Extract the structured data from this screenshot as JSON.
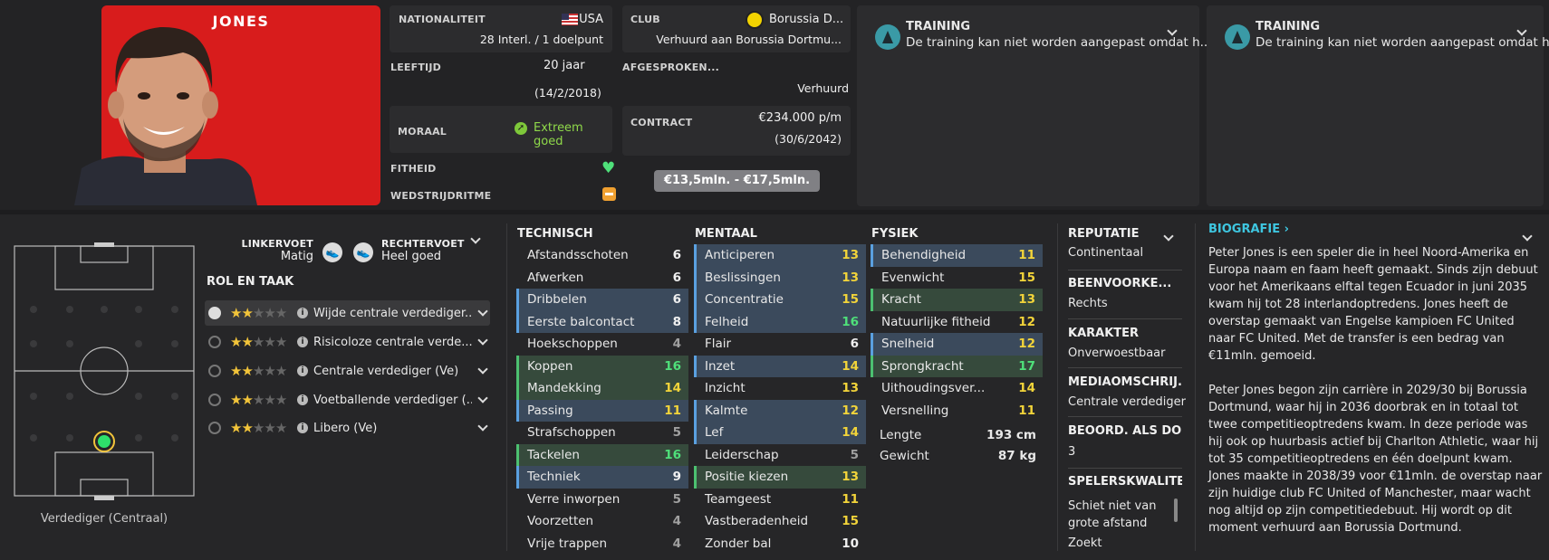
{
  "player": {
    "name": "JONES"
  },
  "info": {
    "nationality_label": "NATIONALITEIT",
    "nationality_value": "USA",
    "caps": "28 Interl. / 1 doelpunt",
    "club_label": "CLUB",
    "club_value": "Borussia D...",
    "club_loan": "Verhuurd aan Borussia Dortmu...",
    "age_label": "LEEFTIJD",
    "age_value": "20 jaar",
    "dob": "(14/2/2018)",
    "agreed_label": "AFGESPROKEN...",
    "agreed_value": "Verhuurd",
    "morale_label": "MORAAL",
    "morale_value": "Extreem goed",
    "contract_label": "CONTRACT",
    "contract_value": "€234.000 p/m",
    "contract_end": "(30/6/2042)",
    "fitness_label": "FITHEID",
    "match_label": "WEDSTRIJDRITME",
    "value_range": "€13,5mln. - €17,5mln."
  },
  "training_cards": [
    {
      "title": "TRAINING",
      "text": "De training kan niet worden aangepast omdat h..."
    },
    {
      "title": "TRAINING",
      "text": "De training kan niet worden aangepast omdat h..."
    }
  ],
  "pitch": {
    "position_caption": "Verdediger (Centraal)"
  },
  "feet": {
    "left_label": "LINKERVOET",
    "left_value": "Matig",
    "right_label": "RECHTERVOET",
    "right_value": "Heel goed"
  },
  "roles": {
    "title": "ROL EN TAAK",
    "items": [
      {
        "label": "Wijde centrale verdediger...",
        "stars": 2
      },
      {
        "label": "Risicoloze centrale verde...",
        "stars": 2
      },
      {
        "label": "Centrale verdediger (Ve)",
        "stars": 2
      },
      {
        "label": "Voetballende verdediger (...",
        "stars": 2
      },
      {
        "label": "Libero (Ve)",
        "stars": 2
      }
    ]
  },
  "attributes": {
    "technical_title": "TECHNISCH",
    "technical": [
      {
        "name": "Afstandsschoten",
        "value": "6",
        "hl": ""
      },
      {
        "name": "Afwerken",
        "value": "6",
        "hl": ""
      },
      {
        "name": "Dribbelen",
        "value": "6",
        "hl": "b"
      },
      {
        "name": "Eerste balcontact",
        "value": "8",
        "hl": "b"
      },
      {
        "name": "Hoekschoppen",
        "value": "4",
        "hl": ""
      },
      {
        "name": "Koppen",
        "value": "16",
        "hl": "g"
      },
      {
        "name": "Mandekking",
        "value": "14",
        "hl": "g"
      },
      {
        "name": "Passing",
        "value": "11",
        "hl": "b"
      },
      {
        "name": "Strafschoppen",
        "value": "5",
        "hl": ""
      },
      {
        "name": "Tackelen",
        "value": "16",
        "hl": "g"
      },
      {
        "name": "Techniek",
        "value": "9",
        "hl": "b"
      },
      {
        "name": "Verre inworpen",
        "value": "5",
        "hl": ""
      },
      {
        "name": "Voorzetten",
        "value": "4",
        "hl": ""
      },
      {
        "name": "Vrije trappen",
        "value": "4",
        "hl": ""
      }
    ],
    "mental_title": "MENTAAL",
    "mental": [
      {
        "name": "Anticiperen",
        "value": "13",
        "hl": "b"
      },
      {
        "name": "Beslissingen",
        "value": "13",
        "hl": "b"
      },
      {
        "name": "Concentratie",
        "value": "15",
        "hl": "b"
      },
      {
        "name": "Felheid",
        "value": "16",
        "hl": "b"
      },
      {
        "name": "Flair",
        "value": "6",
        "hl": ""
      },
      {
        "name": "Inzet",
        "value": "14",
        "hl": "b"
      },
      {
        "name": "Inzicht",
        "value": "13",
        "hl": ""
      },
      {
        "name": "Kalmte",
        "value": "12",
        "hl": "b"
      },
      {
        "name": "Lef",
        "value": "14",
        "hl": "b"
      },
      {
        "name": "Leiderschap",
        "value": "5",
        "hl": ""
      },
      {
        "name": "Positie kiezen",
        "value": "13",
        "hl": "g"
      },
      {
        "name": "Teamgeest",
        "value": "11",
        "hl": ""
      },
      {
        "name": "Vastberadenheid",
        "value": "15",
        "hl": ""
      },
      {
        "name": "Zonder bal",
        "value": "10",
        "hl": ""
      }
    ],
    "physical_title": "FYSIEK",
    "physical": [
      {
        "name": "Behendigheid",
        "value": "11",
        "hl": "b"
      },
      {
        "name": "Evenwicht",
        "value": "15",
        "hl": ""
      },
      {
        "name": "Kracht",
        "value": "13",
        "hl": "g"
      },
      {
        "name": "Natuurlijke fitheid",
        "value": "12",
        "hl": ""
      },
      {
        "name": "Snelheid",
        "value": "12",
        "hl": "b"
      },
      {
        "name": "Sprongkracht",
        "value": "17",
        "hl": "g"
      },
      {
        "name": "Uithoudingsver...",
        "value": "14",
        "hl": ""
      },
      {
        "name": "Versnelling",
        "value": "11",
        "hl": ""
      }
    ],
    "height_label": "Lengte",
    "height_value": "193 cm",
    "weight_label": "Gewicht",
    "weight_value": "87 kg"
  },
  "side": {
    "reputation_label": "REPUTATIE",
    "reputation_value": "Continentaal",
    "foot_label": "BEENVOORKE...",
    "foot_value": "Rechts",
    "character_label": "KARAKTER",
    "character_value": "Onverwoestbaar",
    "media_label": "MEDIAOMSCHRIJ...",
    "media_value": "Centrale verdediger",
    "rating_label": "BEOORD. ALS DO...",
    "rating_value": "3",
    "qualities_label": "SPELERSKWALITEIT",
    "qualities_value1": "Schiet niet van",
    "qualities_value2": "grote afstand",
    "qualities_value3": "Zoekt"
  },
  "bio": {
    "title": "BIOGRAFIE",
    "p1": "Peter Jones is een speler die in heel Noord-Amerika en Europa naam en faam heeft gemaakt. Sinds zijn debuut voor het Amerikaans elftal tegen Ecuador in juni 2035 kwam hij tot 28 interlandoptredens. Jones heeft de overstap gemaakt van Engelse kampioen FC United naar FC United. Met de transfer is een bedrag van €11mln. gemoeid.",
    "p2": "Peter Jones begon zijn carrière in 2029/30 bij Borussia Dortmund, waar hij in 2036 doorbrak en in totaal tot twee competitieoptredens kwam. In deze periode was hij ook op huurbasis actief bij Charlton Athletic, waar hij tot 35 competitieoptredens en één doelpunt kwam. Jones maakte in 2038/39 voor €11mln. de overstap naar zijn huidige club FC United of Manchester, maar wacht nog altijd op zijn competitiedebuut. Hij wordt op dit moment verhuurd aan Borussia Dortmund."
  },
  "colors": {
    "accent_cyan": "#3ec6e0",
    "green_good": "#4fe07a",
    "yellow_mid": "#f2d43a",
    "photo_red": "#d81c1c"
  }
}
